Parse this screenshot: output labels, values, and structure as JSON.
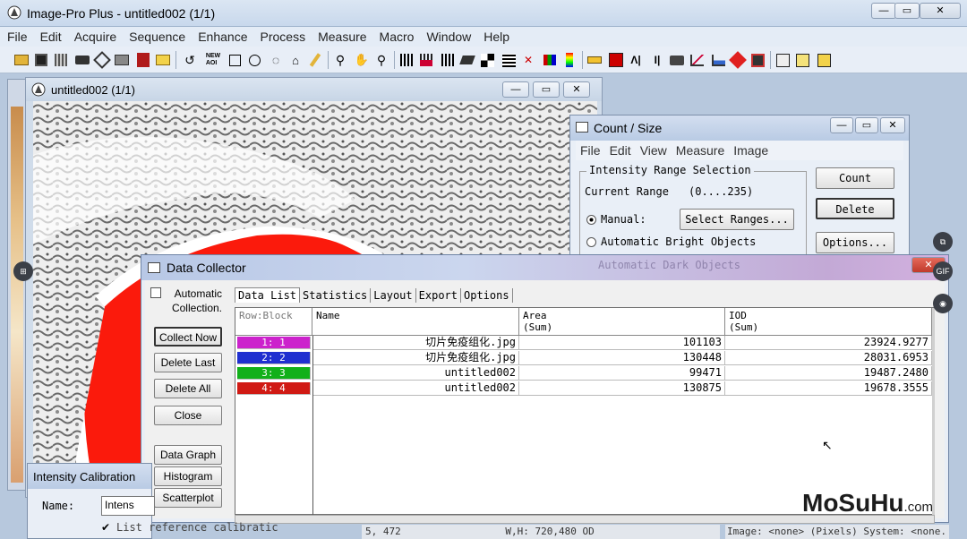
{
  "app": {
    "title": "Image-Pro Plus - untitled002 (1/1)"
  },
  "menu": [
    "File",
    "Edit",
    "Acquire",
    "Sequence",
    "Enhance",
    "Process",
    "Measure",
    "Macro",
    "Window",
    "Help"
  ],
  "image_window": {
    "title": "untitled002 (1/1)"
  },
  "count_size": {
    "title": "Count / Size",
    "menu": [
      "File",
      "Edit",
      "View",
      "Measure",
      "Image"
    ],
    "group_label": "Intensity Range Selection",
    "current_range_label": "Current Range",
    "current_range_value": "(0....235)",
    "manual_label": "Manual:",
    "select_ranges_button": "Select Ranges...",
    "auto_bright_label": "Automatic Bright Objects",
    "auto_dark_label": "Automatic Dark Objects",
    "count_button": "Count",
    "delete_button": "Delete",
    "options_button": "Options..."
  },
  "data_collector": {
    "title": "Data Collector",
    "automatic_collection": "Automatic Collection.",
    "buttons": {
      "collect_now": "Collect Now",
      "delete_last": "Delete Last",
      "delete_all": "Delete All",
      "close": "Close",
      "data_graph": "Data Graph",
      "histogram": "Histogram",
      "scatterplot": "Scatterplot"
    },
    "tabs": [
      "Data List",
      "Statistics",
      "Layout",
      "Export",
      "Options"
    ],
    "columns": [
      "Row:Block",
      "Name",
      "Area\n(Sum)",
      "IOD\n(Sum)"
    ],
    "rows": [
      {
        "block": "1:  1",
        "name": "切片免疫组化.jpg",
        "area": "101103",
        "iod": "23924.9277",
        "color": "#cc22cc"
      },
      {
        "block": "2:  2",
        "name": "切片免疫组化.jpg",
        "area": "130448",
        "iod": "28031.6953",
        "color": "#1f2fd0"
      },
      {
        "block": "3:  3",
        "name": "untitled002",
        "area": "99471",
        "iod": "19487.2480",
        "color": "#12b01a"
      },
      {
        "block": "4:  4",
        "name": "untitled002",
        "area": "130875",
        "iod": "19678.3555",
        "color": "#d01a14"
      }
    ]
  },
  "intensity_calibration": {
    "title": "Intensity Calibration",
    "name_label": "Name:",
    "name_value": "Intens",
    "list_reference": "List reference calibratic"
  },
  "status_bar": {
    "coords": "5, 472",
    "size": "W,H: 720,480 OD",
    "image_info": "Image: <none> (Pixels) System: <none."
  },
  "watermark": {
    "main": "MoSuHu",
    "suffix": ".com"
  },
  "side_icons": [
    "GIF"
  ]
}
